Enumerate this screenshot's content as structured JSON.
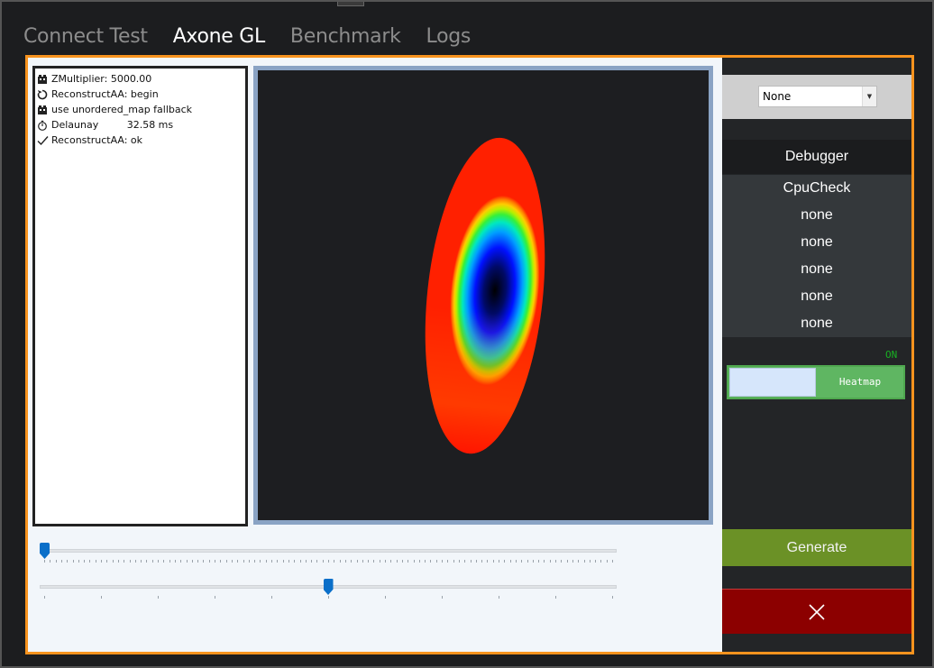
{
  "tabs": [
    {
      "label": "Connect Test",
      "active": false
    },
    {
      "label": "Axone GL",
      "active": true
    },
    {
      "label": "Benchmark",
      "active": false
    },
    {
      "label": "Logs",
      "active": false
    }
  ],
  "log": [
    {
      "icon": "film-icon",
      "text": "ZMultiplier: 5000.00"
    },
    {
      "icon": "refresh-icon",
      "text": "ReconstructAA: begin"
    },
    {
      "icon": "film-icon",
      "text": "use unordered_map fallback"
    },
    {
      "icon": "stopwatch-icon",
      "text": "Delaunay         32.58 ms"
    },
    {
      "icon": "checkmark-icon",
      "text": "ReconstructAA: ok"
    }
  ],
  "sliders": [
    {
      "value_fraction": 0.0
    },
    {
      "value_fraction": 0.5
    }
  ],
  "dropdown": {
    "selected": "None"
  },
  "debugger": {
    "title": "Debugger",
    "items": [
      "CpuCheck",
      "none",
      "none",
      "none",
      "none",
      "none"
    ]
  },
  "toggle": {
    "state_label": "ON",
    "label": "Heatmap",
    "on": true
  },
  "generate_label": "Generate",
  "colors": {
    "accent": "#f7931e",
    "generate": "#6b9126",
    "close": "#8c0000",
    "toggle_on": "#5fb662"
  }
}
